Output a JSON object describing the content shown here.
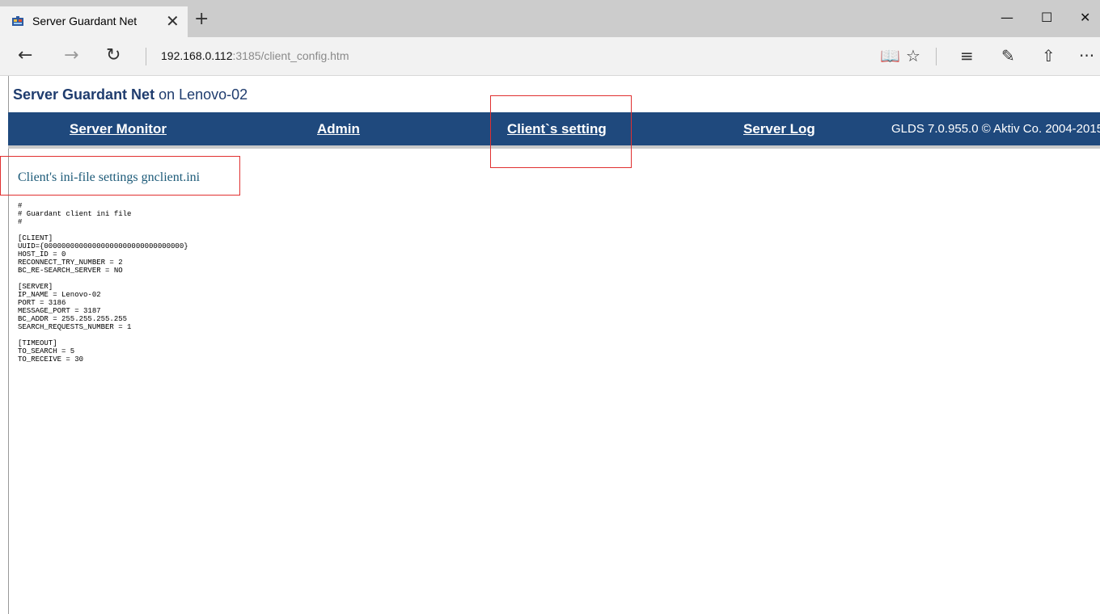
{
  "browser": {
    "tab_title": "Server Guardant Net",
    "tab_close": "✕",
    "new_tab": "+",
    "window": {
      "minimize": "—",
      "maximize": "☐",
      "close": "✕"
    },
    "nav": {
      "back": "←",
      "forward": "→",
      "refresh": "↻"
    },
    "url_host": "192.168.0.112",
    "url_path": ":3185/client_config.htm",
    "toolbar": {
      "reading_view": "📖",
      "favorite": "☆",
      "hub": "≡",
      "notes": "✎",
      "share": "⇧",
      "more": "···"
    }
  },
  "app_header": {
    "brand": "Server Guardant Net",
    "host_suffix": " on Lenovo-02"
  },
  "menu": {
    "items": [
      {
        "label": "Server Monitor"
      },
      {
        "label": "Admin"
      },
      {
        "label": "Client`s setting"
      },
      {
        "label": "Server Log"
      }
    ],
    "copyright": "GLDS 7.0.955.0 © Aktiv Co. 2004-2015"
  },
  "section_title": "Client's ini-file settings gnclient.ini",
  "ini_content": "#\n# Guardant client ini file\n#\n\n[CLIENT]\nUUID={00000000000000000000000000000000}\nHOST_ID = 0\nRECONNECT_TRY_NUMBER = 2\nBC_RE-SEARCH_SERVER = NO\n\n[SERVER]\nIP_NAME = Lenovo-02\nPORT = 3186\nMESSAGE_PORT = 3187\nBC_ADDR = 255.255.255.255\nSEARCH_REQUESTS_NUMBER = 1\n\n[TIMEOUT]\nTO_SEARCH = 5\nTO_RECEIVE = 30"
}
